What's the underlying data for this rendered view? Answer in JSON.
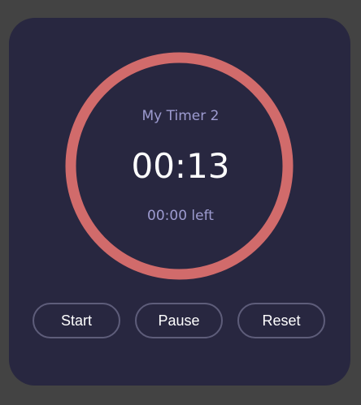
{
  "timer": {
    "name": "My Timer 2",
    "time": "00:13",
    "remaining": "00:00 left"
  },
  "controls": {
    "start_label": "Start",
    "pause_label": "Pause",
    "reset_label": "Reset"
  },
  "colors": {
    "background": "#434343",
    "card": "#282740",
    "ring": "#d16b6b",
    "muted_text": "#9d9bd0",
    "button_border": "#5e5d7a"
  }
}
